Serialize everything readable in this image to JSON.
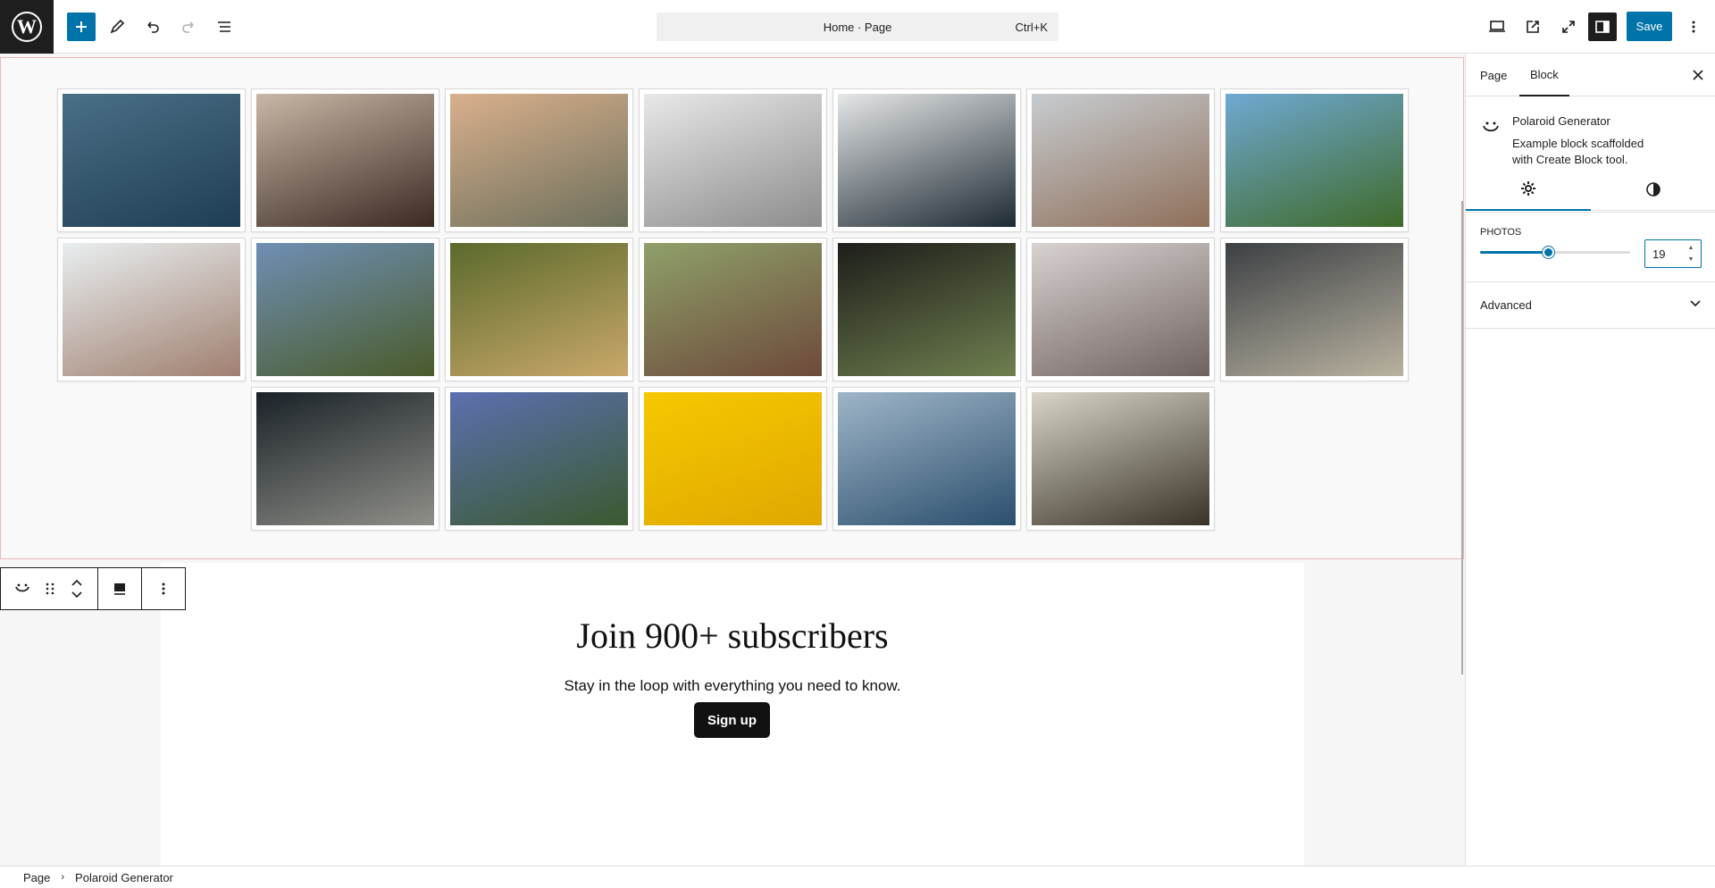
{
  "topbar": {
    "document_title": "Home · Page",
    "shortcut": "Ctrl+K",
    "save_label": "Save",
    "icons": [
      "wordpress-logo",
      "plus-icon",
      "pen-icon",
      "undo-icon",
      "redo-icon",
      "list-view-icon",
      "desktop-icon",
      "external-link-icon",
      "fullscreen-icon",
      "sidebar-icon",
      "more-vertical-icon"
    ]
  },
  "gallery": {
    "photo_count": 19,
    "photos": [
      {
        "colors": [
          "#4a6f86",
          "#1f3e55"
        ]
      },
      {
        "colors": [
          "#c9b7a6",
          "#3a2a23"
        ]
      },
      {
        "colors": [
          "#d9b08c",
          "#6d6f5c"
        ]
      },
      {
        "colors": [
          "#e8e8e8",
          "#8c8c8c"
        ]
      },
      {
        "colors": [
          "#e5e7e8",
          "#1e2a33"
        ]
      },
      {
        "colors": [
          "#c7ccd0",
          "#8f6f5a"
        ]
      },
      {
        "colors": [
          "#6fa9d2",
          "#3f6a2a"
        ]
      },
      {
        "colors": [
          "#e9eef0",
          "#a08070"
        ]
      },
      {
        "colors": [
          "#6f8fb5",
          "#4a5b2a"
        ]
      },
      {
        "colors": [
          "#5b6a2c",
          "#c9a86a"
        ]
      },
      {
        "colors": [
          "#8fa06a",
          "#6d4a3a"
        ]
      },
      {
        "colors": [
          "#1d1e1a",
          "#6f7f4f"
        ]
      },
      {
        "colors": [
          "#d8d2d0",
          "#6e6260"
        ]
      },
      {
        "colors": [
          "#3c4044",
          "#b9b2a0"
        ]
      },
      {
        "colors": [
          "#1a2228",
          "#8f8f88"
        ]
      },
      {
        "colors": [
          "#5d6fb0",
          "#3a5a2f"
        ]
      },
      {
        "colors": [
          "#f6c800",
          "#e0a800"
        ]
      },
      {
        "colors": [
          "#9fb5c8",
          "#2b4f6d"
        ]
      },
      {
        "colors": [
          "#d8d6c8",
          "#3a3228"
        ]
      }
    ]
  },
  "cta": {
    "title": "Join 900+ subscribers",
    "subtitle": "Stay in the loop with everything you need to know.",
    "button": "Sign up"
  },
  "sidebar": {
    "tabs": [
      "Page",
      "Block"
    ],
    "block_title": "Polaroid Generator",
    "block_description": "Example block scaffolded with Create Block tool.",
    "photos_label": "Photos",
    "photos_value": "19",
    "photos_fraction": 0.45,
    "advanced_label": "Advanced"
  },
  "breadcrumb": [
    "Page",
    "Polaroid Generator"
  ],
  "colors": {
    "accent": "#0073aa",
    "selection_border": "#f0b5b5",
    "cta_button": "#111111"
  }
}
